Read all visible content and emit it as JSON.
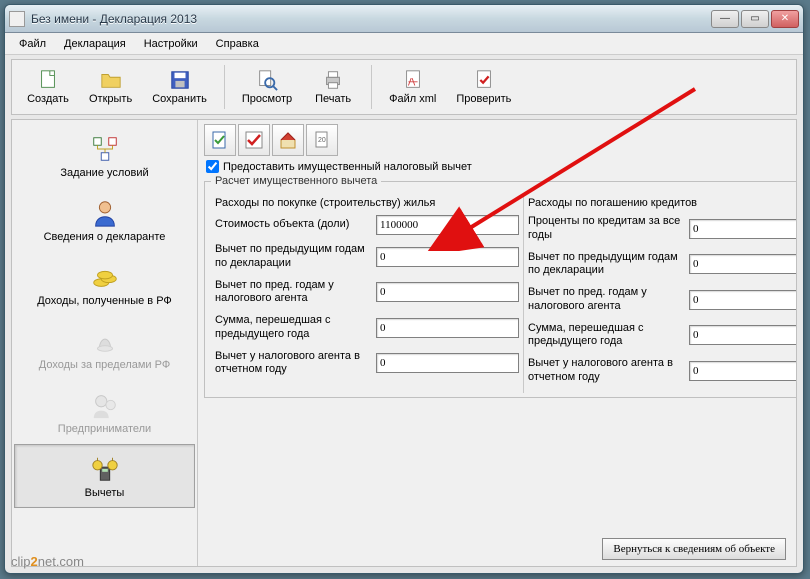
{
  "window": {
    "title": "Без имени - Декларация 2013"
  },
  "menu": {
    "file": "Файл",
    "decl": "Декларация",
    "settings": "Настройки",
    "help": "Справка"
  },
  "toolbar": {
    "create": "Создать",
    "open": "Открыть",
    "save": "Сохранить",
    "preview": "Просмотр",
    "print": "Печать",
    "xml": "Файл xml",
    "check": "Проверить"
  },
  "sidebar": {
    "items": [
      {
        "label": "Задание условий"
      },
      {
        "label": "Сведения о декларанте"
      },
      {
        "label": "Доходы, полученные в РФ"
      },
      {
        "label": "Доходы за пределами РФ"
      },
      {
        "label": "Предприниматели"
      },
      {
        "label": "Вычеты"
      }
    ]
  },
  "form": {
    "checkbox_label": "Предоставить имущественный налоговый вычет",
    "group_title": "Расчет имущественного вычета",
    "left": {
      "title": "Расходы по покупке (строительству) жилья",
      "fields": [
        {
          "label": "Стоимость объекта (доли)",
          "value": "1100000"
        },
        {
          "label": "Вычет по предыдущим годам по декларации",
          "value": "0"
        },
        {
          "label": "Вычет по пред. годам у налогового агента",
          "value": "0"
        },
        {
          "label": "Сумма, перешедшая с предыдущего года",
          "value": "0"
        },
        {
          "label": "Вычет у налогового агента в отчетном году",
          "value": "0"
        }
      ]
    },
    "right": {
      "title": "Расходы по погашению кредитов",
      "fields": [
        {
          "label": "Проценты по кредитам за все годы",
          "value": "0"
        },
        {
          "label": "Вычет по предыдущим годам по декларации",
          "value": "0"
        },
        {
          "label": "Вычет по пред. годам у налогового агента",
          "value": "0"
        },
        {
          "label": "Сумма, перешедшая с предыдущего года",
          "value": "0"
        },
        {
          "label": "Вычет у налогового агента в отчетном году",
          "value": "0"
        }
      ]
    },
    "back_button": "Вернуться к сведениям об объекте"
  },
  "watermark": {
    "pre": "clip",
    "mid": "2",
    "post": "net.com"
  },
  "icons": {
    "conditions": "conditions-icon",
    "declarant": "declarant-icon",
    "income_ru": "income-ru-icon",
    "income_abroad": "income-abroad-icon",
    "entrepreneur": "entrepreneur-icon",
    "deductions": "deductions-icon"
  },
  "colors": {
    "arrow": "#e01010"
  }
}
